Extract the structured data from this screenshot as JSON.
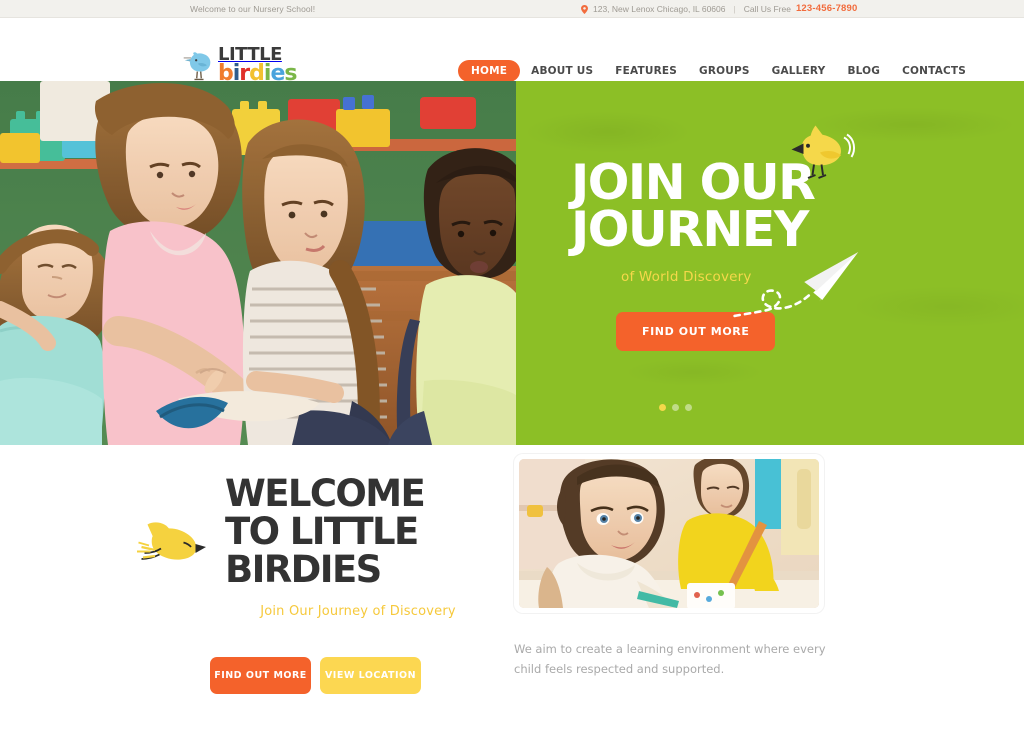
{
  "topbar": {
    "welcome_text": "Welcome to our Nursery School!",
    "pin_icon": "location-pin-icon",
    "address": "123, New Lenox Chicago, IL 60606",
    "separator": "|",
    "call_label": "Call Us Free",
    "phone": "123-456-7890"
  },
  "header": {
    "logo": {
      "bird_icon": "blue-bird-icon",
      "line1": "LITTLE",
      "line2": "birdies",
      "letters": [
        {
          "char": "b",
          "color": "#f07d2e"
        },
        {
          "char": "i",
          "color": "#2f5d8c"
        },
        {
          "char": "r",
          "color": "#e0302a"
        },
        {
          "char": "d",
          "color": "#f2c131"
        },
        {
          "char": "i",
          "color": "#7ab648"
        },
        {
          "char": "e",
          "color": "#4aa3dd"
        },
        {
          "char": "s",
          "color": "#7ab648"
        }
      ]
    },
    "nav": [
      {
        "label": "HOME",
        "active": true
      },
      {
        "label": "ABOUT US",
        "active": false
      },
      {
        "label": "FEATURES",
        "active": false
      },
      {
        "label": "GROUPS",
        "active": false
      },
      {
        "label": "GALLERY",
        "active": false
      },
      {
        "label": "BLOG",
        "active": false
      },
      {
        "label": "CONTACTS",
        "active": false
      }
    ]
  },
  "hero": {
    "photo_alt": "teacher reading a book with four children in a classroom",
    "title_line1": "JOIN OUR",
    "title_line2": "JOURNEY",
    "subtitle": "of World Discovery",
    "button_label": "FIND OUT MORE",
    "bird_icon": "yellow-bird-icon",
    "plane_icon": "paper-plane-icon",
    "dots": [
      {
        "active": true
      },
      {
        "active": false
      },
      {
        "active": false
      }
    ]
  },
  "welcome": {
    "bird_icon": "yellow-flying-bird-icon",
    "title": "WELCOME TO LITTLE BIRDIES",
    "subtitle": "Join Our Journey of Discovery",
    "buttons": [
      {
        "label": "FIND OUT MORE",
        "style": "orange"
      },
      {
        "label": "VIEW LOCATION",
        "style": "yellow"
      }
    ],
    "photo_alt": "two young girls drawing at a table with colored pencils",
    "paragraph": "We aim to create a learning environment where every child feels respected and supported."
  },
  "colors": {
    "accent_orange": "#f4622b",
    "accent_yellow": "#fcd751",
    "hero_green": "#8cbf26",
    "topbar_bg": "#f2f1ed",
    "heading_dark": "#333333",
    "muted_text": "#a9a9a9"
  }
}
